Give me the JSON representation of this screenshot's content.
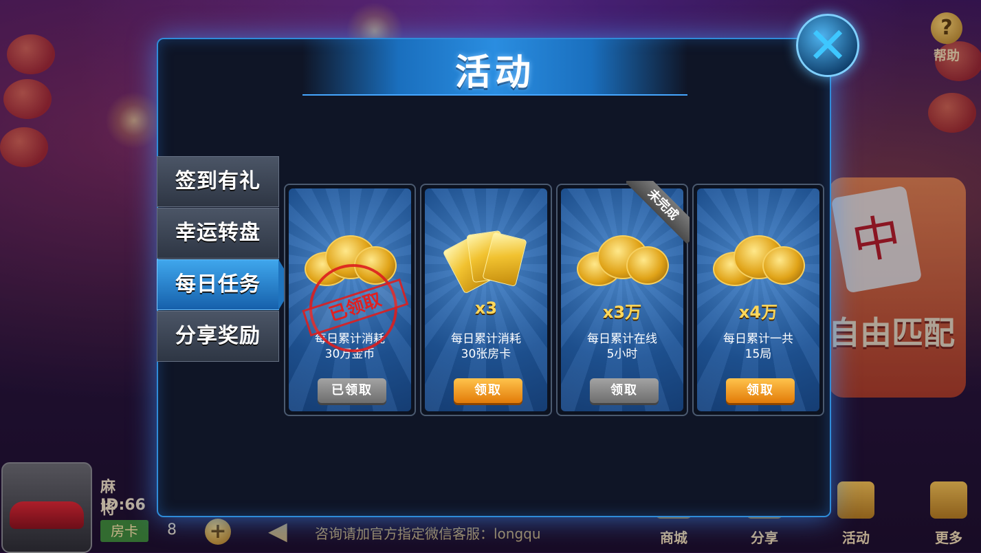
{
  "dialog": {
    "title": "活动"
  },
  "tabs": [
    {
      "label": "签到有礼",
      "active": false
    },
    {
      "label": "幸运转盘",
      "active": false
    },
    {
      "label": "每日任务",
      "active": true
    },
    {
      "label": "分享奖励",
      "active": false
    }
  ],
  "tasks": [
    {
      "reward_icon": "gold-coins-icon",
      "quantity": "",
      "desc_line1": "每日累计消耗",
      "desc_line2": "30万金币",
      "button": "已领取",
      "state": "claimed",
      "stamp": "已领取",
      "ribbon": ""
    },
    {
      "reward_icon": "room-cards-icon",
      "quantity": "x3",
      "desc_line1": "每日累计消耗",
      "desc_line2": "30张房卡",
      "button": "领取",
      "state": "claimable",
      "stamp": "",
      "ribbon": ""
    },
    {
      "reward_icon": "gold-coins-icon",
      "quantity": "x3万",
      "desc_line1": "每日累计在线",
      "desc_line2": "5小时",
      "button": "领取",
      "state": "disabled",
      "stamp": "",
      "ribbon": "未完成"
    },
    {
      "reward_icon": "gold-coins-icon",
      "quantity": "x4万",
      "desc_line1": "每日累计一共",
      "desc_line2": "15局",
      "button": "领取",
      "state": "claimable",
      "stamp": "",
      "ribbon": ""
    }
  ],
  "help": {
    "label": "帮助"
  },
  "game_mode": {
    "label": "自由匹配",
    "tile": "中"
  },
  "player": {
    "name": "麻将神",
    "id": "ID:66",
    "card_label": "房卡",
    "card_count": "8"
  },
  "notice": "咨询请加官方指定微信客服：longqu",
  "bottom_nav": [
    {
      "label": "商城"
    },
    {
      "label": "分享"
    },
    {
      "label": "活动"
    },
    {
      "label": "更多"
    }
  ],
  "colors": {
    "accent": "#2a8de0",
    "claim": "#f0a020",
    "claimed": "#8a8a8a",
    "stamp": "#e02020"
  }
}
